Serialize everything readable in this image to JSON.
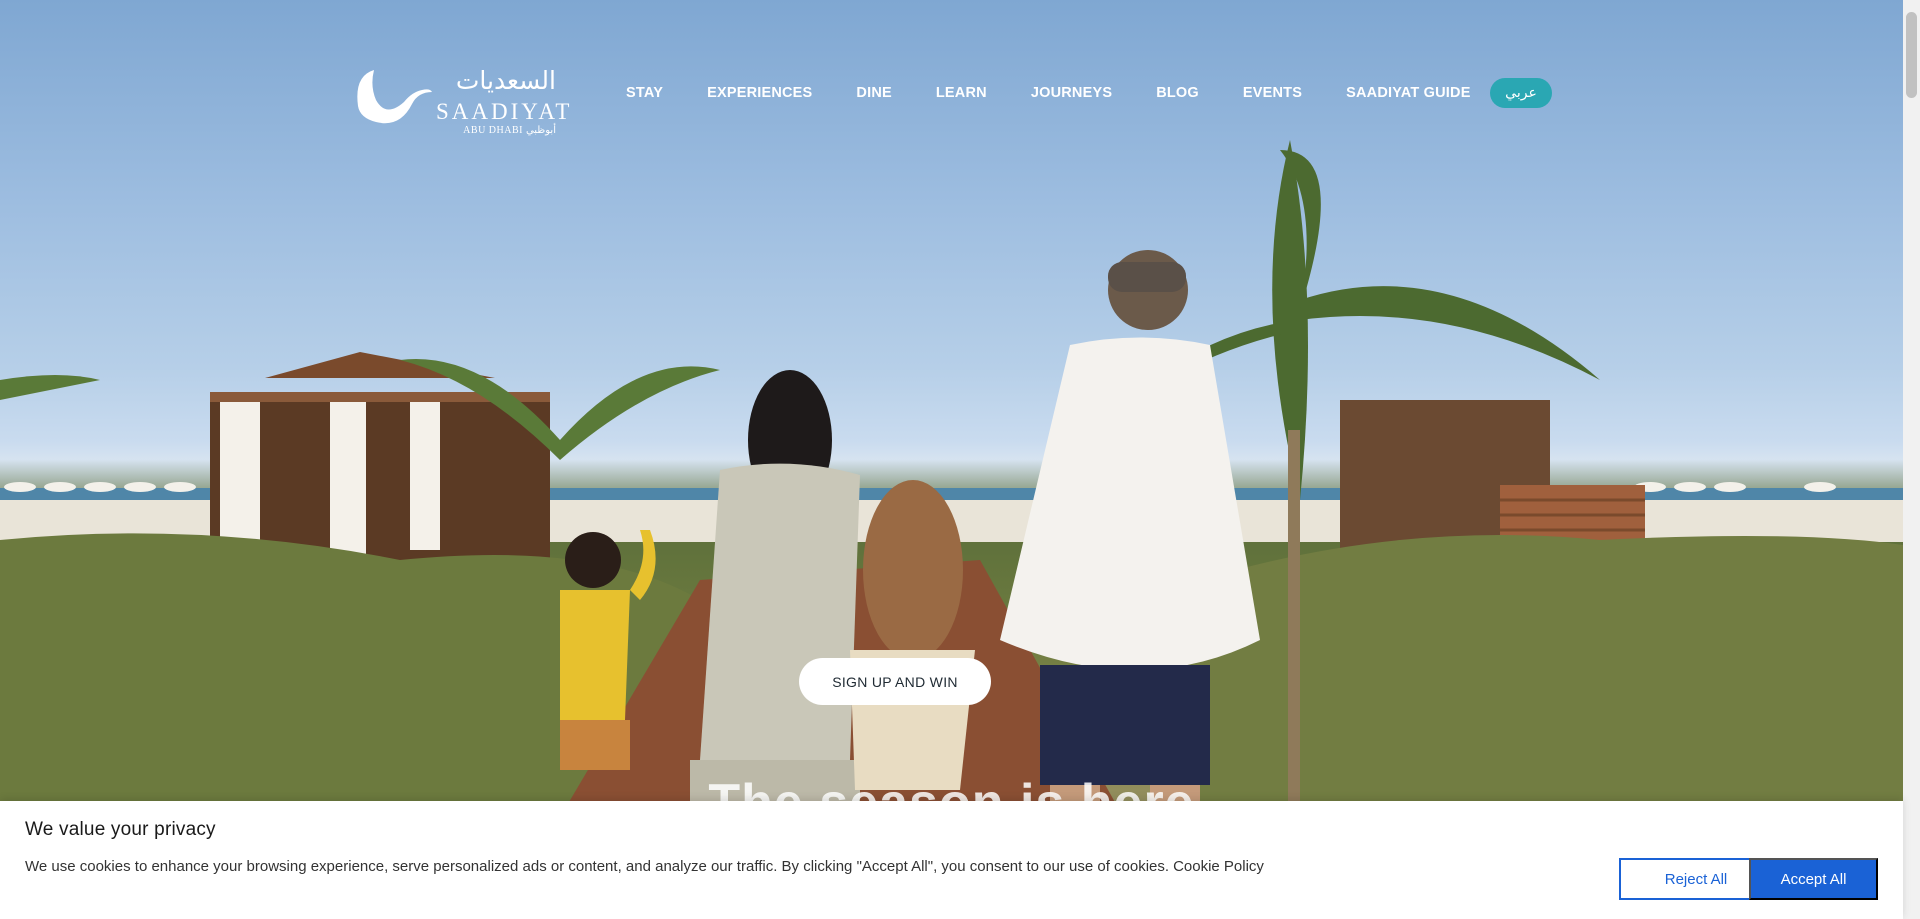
{
  "header": {
    "logo": {
      "arabic_name": "السعديات",
      "english_name": "SAADIYAT",
      "sub_text": "ABU DHABI  أبوظبي"
    },
    "nav": [
      {
        "label": "STAY"
      },
      {
        "label": "EXPERIENCES"
      },
      {
        "label": "DINE"
      },
      {
        "label": "LEARN"
      },
      {
        "label": "JOURNEYS"
      },
      {
        "label": "BLOG"
      },
      {
        "label": "EVENTS"
      },
      {
        "label": "SAADIYAT GUIDE"
      }
    ],
    "language_button": "عربي",
    "language_button_color": "#2aa7b3"
  },
  "hero": {
    "cta_label": "SIGN UP AND WIN",
    "tagline": "The season is here"
  },
  "cookie_banner": {
    "title": "We value your privacy",
    "text": "We use cookies to enhance your browsing experience, serve personalized ads or content, and analyze our traffic. By clicking \"Accept All\", you consent to our use of cookies.",
    "policy_link": "Cookie Policy",
    "reject_label": "Reject All",
    "accept_label": "Accept All",
    "accent_color": "#1a62d6"
  }
}
